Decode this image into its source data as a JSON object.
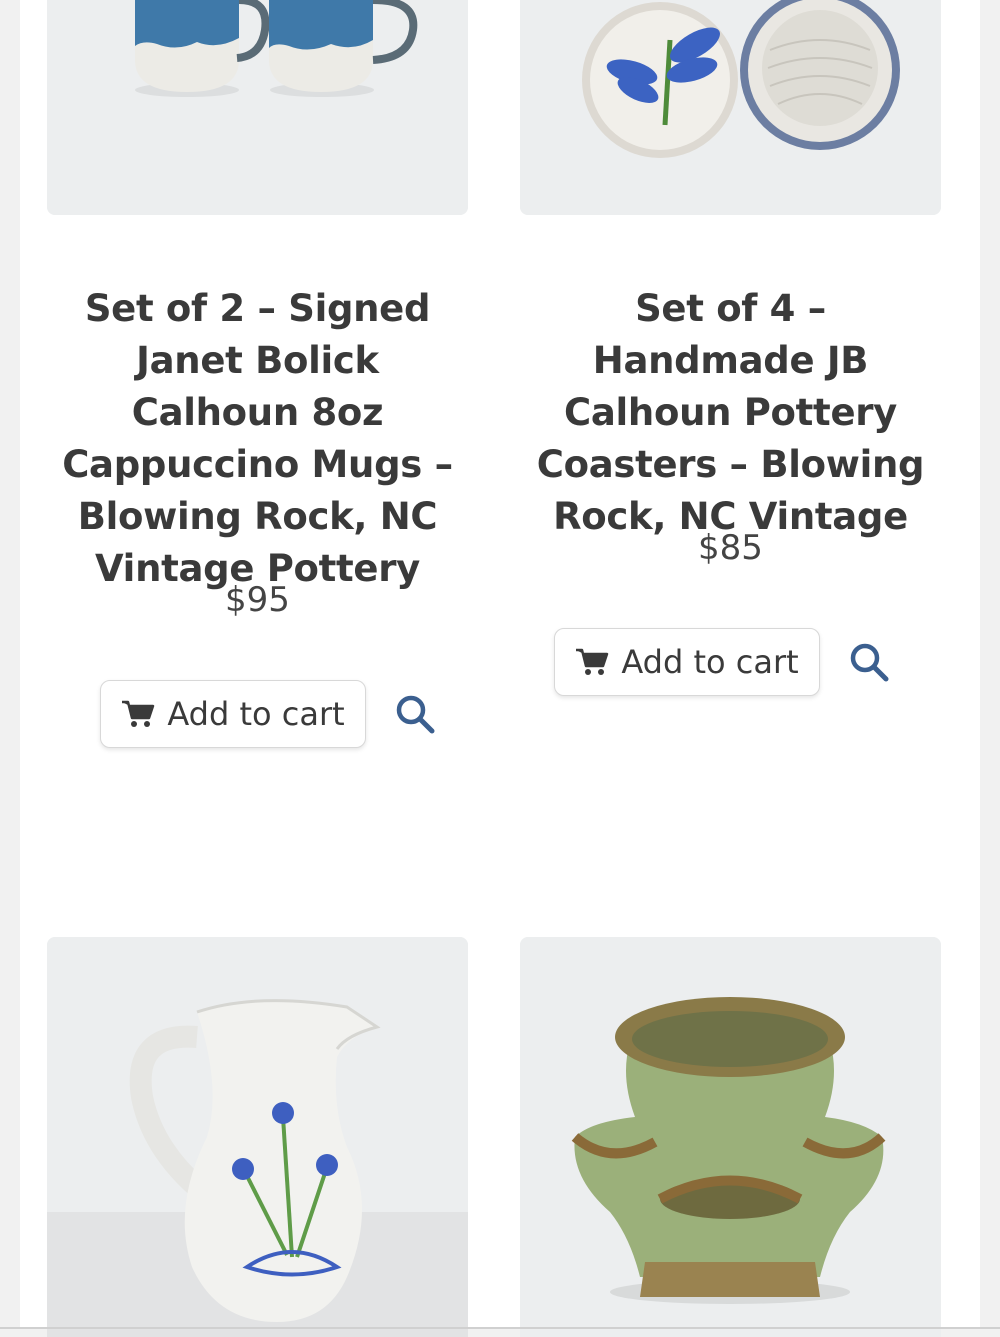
{
  "products": [
    {
      "title": "Set of 2 – Signed Janet Bolick Calhoun 8oz Cappuccino Mugs – Blowing Rock, NC Vintage Pottery",
      "price": "$95",
      "add_to_cart_label": "Add to cart",
      "image_icon": "mugs-image"
    },
    {
      "title": "Set of 4 – Handmade JB Calhoun Pottery Coasters – Blowing Rock, NC Vintage",
      "price": "$85",
      "add_to_cart_label": "Add to cart",
      "image_icon": "coasters-image"
    },
    {
      "image_icon": "pitcher-image"
    },
    {
      "image_icon": "strawberry-pot-image"
    }
  ],
  "colors": {
    "accent": "#3b5f8f",
    "title_text": "#3a3a3a",
    "price_text": "#444444",
    "image_bg": "#eef0f1"
  },
  "icons": {
    "cart": "shopping-cart-icon",
    "search": "magnifier-icon"
  }
}
